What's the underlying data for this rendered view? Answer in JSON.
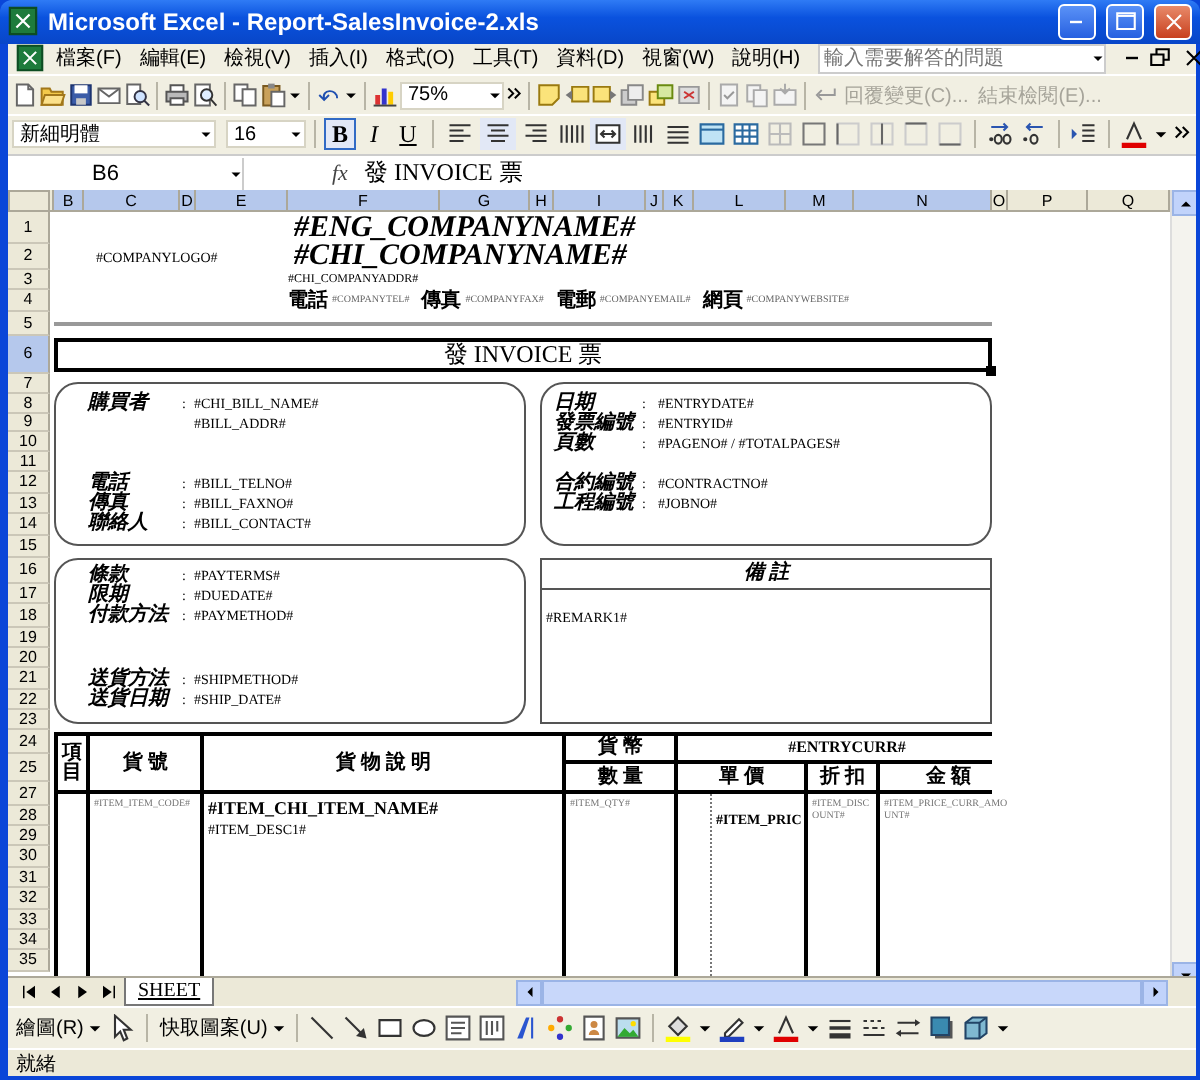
{
  "window": {
    "title": "Microsoft Excel - Report-SalesInvoice-2.xls"
  },
  "menu": [
    "檔案(F)",
    "編輯(E)",
    "檢視(V)",
    "插入(I)",
    "格式(O)",
    "工具(T)",
    "資料(D)",
    "視窗(W)",
    "說明(H)"
  ],
  "help_box": {
    "placeholder": "輸入需要解答的問題"
  },
  "toolbar": {
    "zoom": "75%",
    "review_buttons": [
      {
        "label": "回覆變更(C)...",
        "disabled": true
      },
      {
        "label": "結束檢閱(E)...",
        "disabled": true
      }
    ]
  },
  "format_toolbar": {
    "font": "新細明體",
    "size": "16",
    "bold_label": "B",
    "italic_label": "I",
    "underline_label": "U",
    "bold": true,
    "italic": false,
    "underline": false,
    "align_left": false,
    "align_center": true,
    "align_right": false,
    "merge_center": true
  },
  "formula_bar": {
    "name_box": "B6",
    "fx": "fx",
    "content": "發 INVOICE 票"
  },
  "columns": [
    {
      "label": "B",
      "selected": true
    },
    {
      "label": "C",
      "selected": true
    },
    {
      "label": "D",
      "selected": true
    },
    {
      "label": "E",
      "selected": true
    },
    {
      "label": "F",
      "selected": true
    },
    {
      "label": "G",
      "selected": true
    },
    {
      "label": "H",
      "selected": true
    },
    {
      "label": "I",
      "selected": true
    },
    {
      "label": "J",
      "selected": true
    },
    {
      "label": "K",
      "selected": true
    },
    {
      "label": "L",
      "selected": true
    },
    {
      "label": "M",
      "selected": true
    },
    {
      "label": "N",
      "selected": true
    },
    {
      "label": "O",
      "selected": false
    },
    {
      "label": "P",
      "selected": false
    },
    {
      "label": "Q",
      "selected": false
    }
  ],
  "rows": [
    {
      "label": "1",
      "selected": false
    },
    {
      "label": "2",
      "selected": false
    },
    {
      "label": "3",
      "selected": false
    },
    {
      "label": "4",
      "selected": false
    },
    {
      "label": "5",
      "selected": false
    },
    {
      "label": "6",
      "selected": true
    },
    {
      "label": "7",
      "selected": false
    },
    {
      "label": "8",
      "selected": false
    },
    {
      "label": "9",
      "selected": false
    },
    {
      "label": "10",
      "selected": false
    },
    {
      "label": "11",
      "selected": false
    },
    {
      "label": "12",
      "selected": false
    },
    {
      "label": "13",
      "selected": false
    },
    {
      "label": "14",
      "selected": false
    },
    {
      "label": "15",
      "selected": false
    },
    {
      "label": "16",
      "selected": false
    },
    {
      "label": "17",
      "selected": false
    },
    {
      "label": "18",
      "selected": false
    },
    {
      "label": "19",
      "selected": false
    },
    {
      "label": "20",
      "selected": false
    },
    {
      "label": "21",
      "selected": false
    },
    {
      "label": "22",
      "selected": false
    },
    {
      "label": "23",
      "selected": false
    },
    {
      "label": "24",
      "selected": false
    },
    {
      "label": "25",
      "selected": false
    },
    {
      "label": "27",
      "selected": false
    },
    {
      "label": "28",
      "selected": false
    },
    {
      "label": "29",
      "selected": false
    },
    {
      "label": "30",
      "selected": false
    },
    {
      "label": "31",
      "selected": false
    },
    {
      "label": "32",
      "selected": false
    },
    {
      "label": "33",
      "selected": false
    },
    {
      "label": "34",
      "selected": false
    },
    {
      "label": "35",
      "selected": false
    }
  ],
  "sheet": {
    "eng_company_name": "#ENG_COMPANYNAME#",
    "company_logo": "#COMPANYLOGO#",
    "chi_company_name": "#CHI_COMPANYNAME#",
    "company_address": "#CHI_COMPANYADDR#",
    "contacts": [
      {
        "label": "電話",
        "value": "#COMPANYTEL#"
      },
      {
        "label": "傳真",
        "value": "#COMPANYFAX#"
      },
      {
        "label": "電郵",
        "value": "#COMPANYEMAIL#"
      },
      {
        "label": "網頁",
        "value": "#COMPANYWEBSITE#"
      }
    ],
    "title": {
      "text": "發 INVOICE 票",
      "selected": true
    },
    "bill_box": [
      [
        {
          "label": "購買者",
          "sep": ":",
          "value": "#CHI_BILL_NAME#"
        },
        {
          "value": "#BILL_ADDR#"
        }
      ],
      [
        {
          "label": "電話",
          "sep": ":",
          "value": "#BILL_TELNO#"
        },
        {
          "label": "傳真",
          "sep": ":",
          "value": "#BILL_FAXNO#"
        },
        {
          "label": "聯絡人",
          "sep": ":",
          "value": "#BILL_CONTACT#"
        }
      ]
    ],
    "entry_box": [
      [
        {
          "label": "日期",
          "sep": ":",
          "value": "#ENTRYDATE#"
        },
        {
          "label": "發票編號",
          "sep": ":",
          "value": "#ENTRYID#"
        },
        {
          "label": "頁數",
          "sep": ":",
          "value": "#PAGENO# / #TOTALPAGES#"
        }
      ],
      [
        {
          "label": "合約編號",
          "sep": ":",
          "value": "#CONTRACTNO#"
        },
        {
          "label": "工程編號",
          "sep": ":",
          "value": "#JOBNO#"
        }
      ]
    ],
    "payment_box": [
      [
        {
          "label": "條款",
          "sep": ":",
          "value": "#PAYTERMS#"
        },
        {
          "label": "限期",
          "sep": ":",
          "value": "#DUEDATE#"
        },
        {
          "label": "付款方法",
          "sep": ":",
          "value": "#PAYMETHOD#"
        }
      ],
      [
        {
          "label": "送貨方法",
          "sep": ":",
          "value": "#SHIPMETHOD#"
        },
        {
          "label": "送貨日期",
          "sep": ":",
          "value": "#SHIP_DATE#"
        }
      ]
    ],
    "remarks": {
      "heading": "備 註",
      "value": "#REMARK1#"
    },
    "item_table": {
      "item_no": "項目",
      "code": "貨 號",
      "description": "貨 物 說 明",
      "currency_label": "貨 幣",
      "currency": "#ENTRYCURR#",
      "quantity": "數 量",
      "unit_price": "單 價",
      "discount": "折 扣",
      "amount": "金 額",
      "row": {
        "code": "#ITEM_ITEM_CODE#",
        "name": "#ITEM_CHI_ITEM_NAME#",
        "desc": "#ITEM_DESC1#",
        "quantity": "#ITEM_QTY#",
        "price": "#ITEM_PRIC",
        "discount": "#ITEM_DISCOUNT#",
        "amount": "#ITEM_PRICE_CURR_AMOUNT#"
      }
    }
  },
  "sheet_tabs": [
    {
      "label": "SHEET",
      "selected": true
    }
  ],
  "drawing_toolbar": {
    "draw": "繪圖(R)",
    "autoshapes": "快取圖案(U)"
  },
  "status_bar": "就緒"
}
